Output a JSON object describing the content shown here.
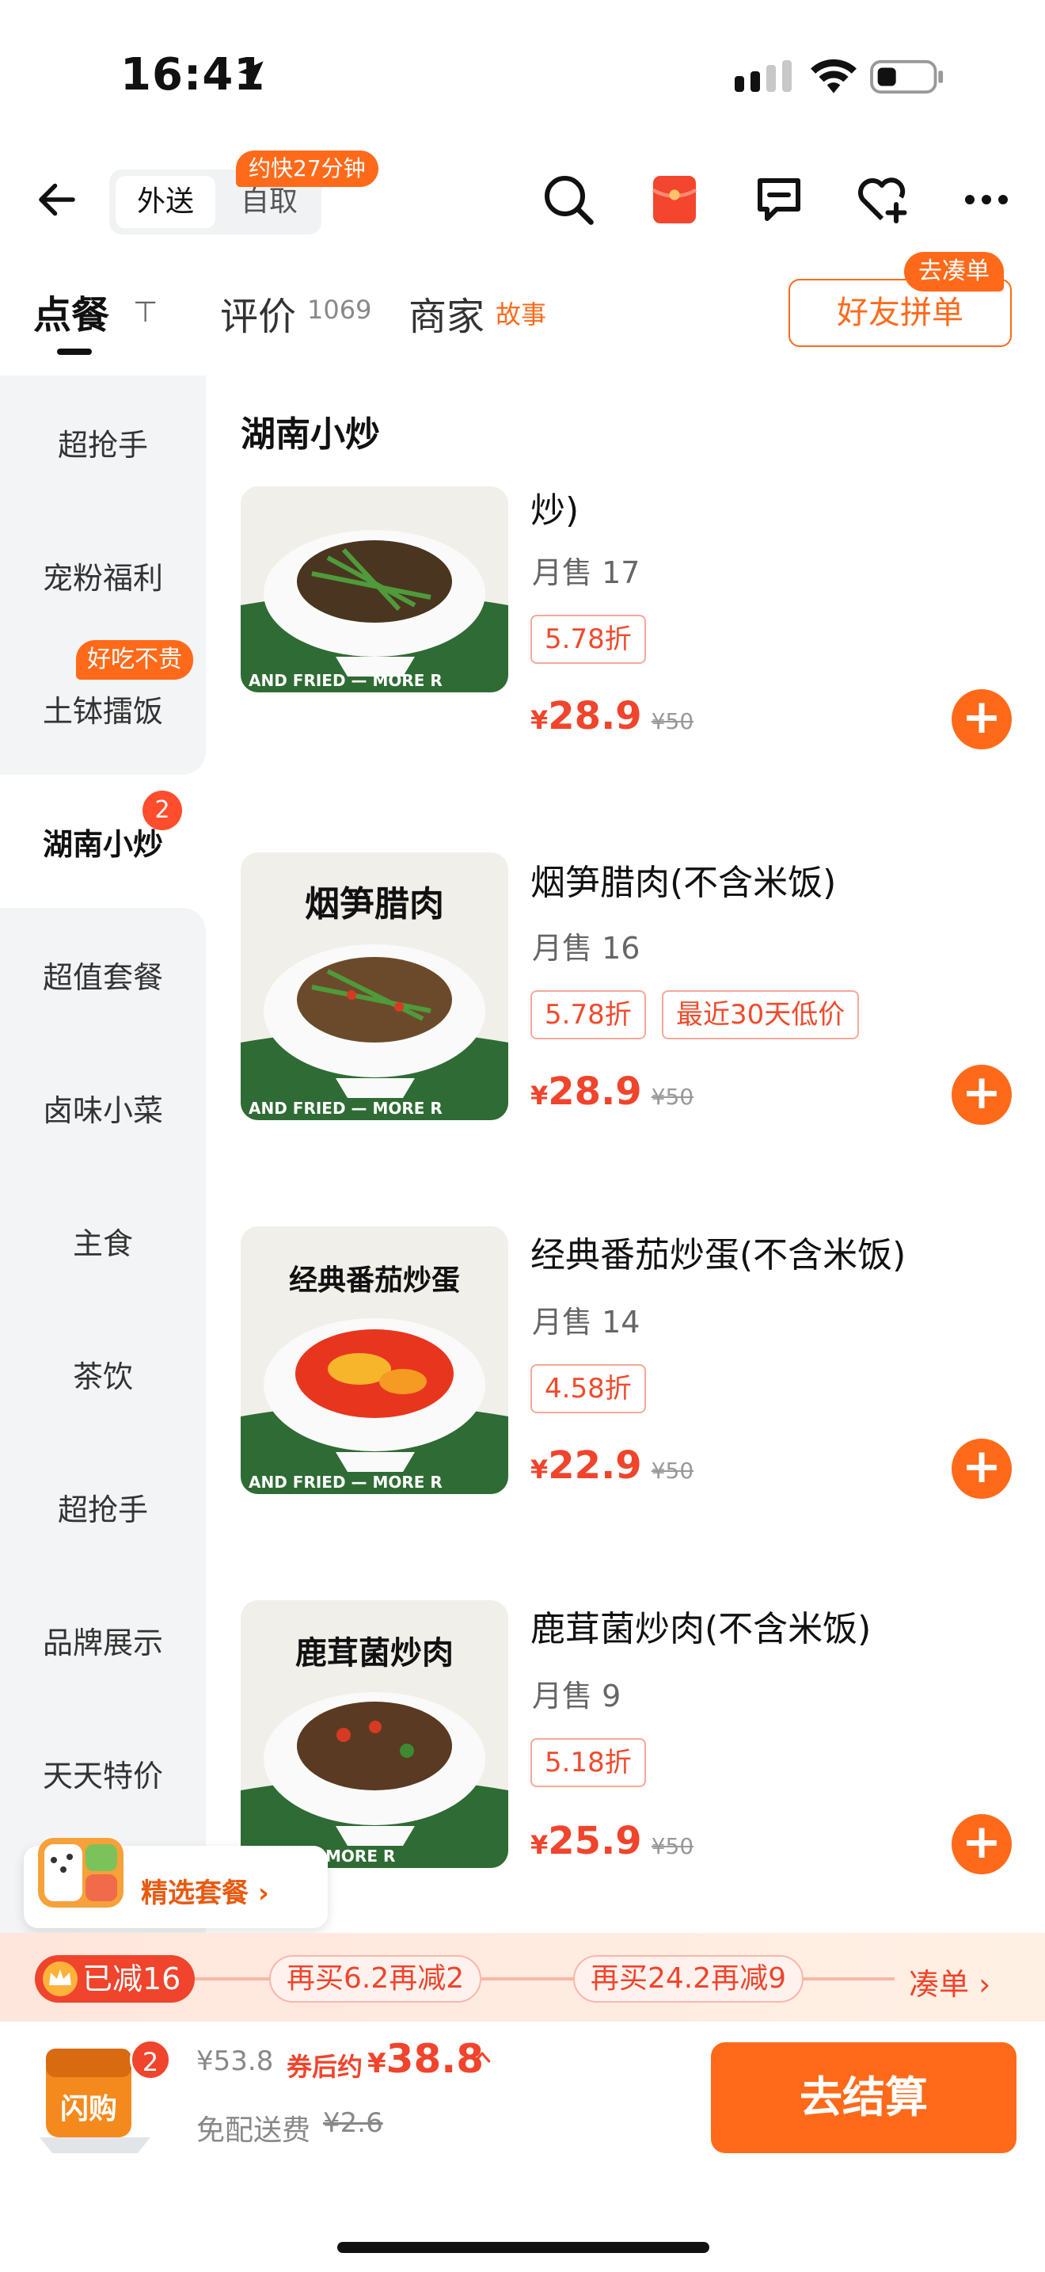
{
  "status_bar": {
    "time": "16:41"
  },
  "top_nav": {
    "mode_active": "外送",
    "mode_inactive": "自取",
    "eta_badge": "约快27分钟"
  },
  "tabs": {
    "order": "点餐",
    "review": "评价",
    "review_count": "1069",
    "shop": "商家",
    "shop_story": "故事",
    "pin_glyph": "⊤"
  },
  "friend_order": {
    "label": "好友拼单",
    "badge": "去凑单"
  },
  "sidebar": {
    "items": [
      {
        "label": "超抢手"
      },
      {
        "label": "宠粉福利"
      },
      {
        "label": "土钵擂饭",
        "tag": "好吃不贵"
      },
      {
        "label": "湖南小炒",
        "count": "2",
        "active": true
      },
      {
        "label": "超值套餐"
      },
      {
        "label": "卤味小菜"
      },
      {
        "label": "主食"
      },
      {
        "label": "茶饮"
      },
      {
        "label": "超抢手"
      },
      {
        "label": "品牌展示"
      },
      {
        "label": "天天特价"
      }
    ]
  },
  "section": {
    "title": "湖南小炒"
  },
  "dishes": [
    {
      "name": "炒)",
      "sales": "月售 17",
      "discount": "5.78折",
      "price": "28.9",
      "orig": "¥50",
      "img_caption": "AND FRIED — MORE R",
      "plate_title": ""
    },
    {
      "name": "烟笋腊肉(不含米饭)",
      "sales": "月售 16",
      "discount": "5.78折",
      "extra_tag": "最近30天低价",
      "price": "28.9",
      "orig": "¥50",
      "img_caption": "AND FRIED — MORE R",
      "plate_title": "烟笋腊肉"
    },
    {
      "name": "经典番茄炒蛋(不含米饭)",
      "sales": "月售 14",
      "discount": "4.58折",
      "price": "22.9",
      "orig": "¥50",
      "img_caption": "AND FRIED — MORE R",
      "plate_title": "经典番茄炒蛋"
    },
    {
      "name": "鹿茸菌炒肉(不含米饭)",
      "sales": "月售 9",
      "discount": "5.18折",
      "price": "25.9",
      "orig": "¥50",
      "img_caption": "RIED — MORE R",
      "plate_title": "鹿茸菌炒肉"
    }
  ],
  "currency": "¥",
  "add_glyph": "+",
  "promo_chip": {
    "label": "精选套餐 ›"
  },
  "discount_bar": {
    "reduced": "已减16",
    "step1": "再买6.2再减2",
    "step2": "再买24.2再减9",
    "gather": "凑单 ›"
  },
  "checkout": {
    "cart_count": "2",
    "cart_label": "闪购",
    "orig_total": "¥53.8",
    "after_label": "券后约",
    "final_price": "38.8",
    "free_ship": "免配送费",
    "ship_orig": "¥2.6",
    "button": "去结算"
  },
  "colors": {
    "accent": "#ff6a1a",
    "price_red": "#f0442c",
    "sidebar_bg": "#f3f4f6"
  },
  "icons": [
    "location-arrow-icon",
    "signal-icon",
    "wifi-icon",
    "battery-icon",
    "back-arrow-icon",
    "search-icon",
    "red-packet-icon",
    "chat-icon",
    "heart-plus-icon",
    "more-icon",
    "crown-icon",
    "caret-up-icon"
  ]
}
